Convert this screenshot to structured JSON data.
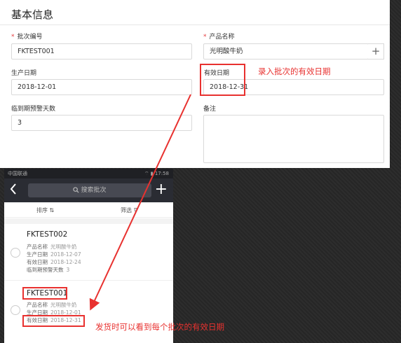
{
  "form": {
    "title": "基本信息",
    "batch_no_label": "批次编号",
    "batch_no_value": "FKTEST001",
    "product_label": "产品名称",
    "product_value": "光明酸牛奶",
    "add_symbol": "+",
    "prod_date_label": "生产日期",
    "prod_date_value": "2018-12-01",
    "exp_date_label": "有效日期",
    "exp_date_value": "2018-12-31",
    "warn_days_label": "临到期预警天数",
    "warn_days_value": "3",
    "remark_label": "备注",
    "required_mark": "*"
  },
  "annotations": {
    "top": "录入批次的有效日期",
    "bottom": "发货时可以看到每个批次的有效日期",
    "accent_color": "#e8312f"
  },
  "phone": {
    "carrier": "中国联通",
    "status_right": "⌔ ▮ 17:58",
    "back_icon": "back-chevron",
    "search_placeholder": "搜索批次",
    "add_symbol": "+",
    "sort_label": "排序 ⇅",
    "filter_label": "筛选 ⊽",
    "items": [
      {
        "code": "FKTEST002",
        "product_key": "产品名称",
        "product": "光明酸牛奶",
        "prod_key": "生产日期",
        "prod_date": "2018-12-07",
        "exp_key": "有效日期",
        "exp_date": "2018-12-24",
        "warn_key": "临到期预警天数",
        "warn_days": "3"
      },
      {
        "code": "FKTEST001",
        "product_key": "产品名称",
        "product": "光明酸牛奶",
        "prod_key": "生产日期",
        "prod_date": "2018-12-01",
        "exp_key": "有效日期",
        "exp_date": "2018-12-31"
      }
    ]
  }
}
